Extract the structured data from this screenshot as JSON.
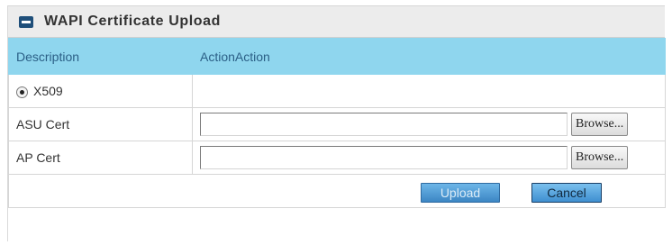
{
  "panel": {
    "title": "WAPI Certificate Upload"
  },
  "table": {
    "headers": [
      "Description",
      "ActionAction"
    ],
    "radio": {
      "label": "X509",
      "checked": true
    },
    "rows": [
      {
        "label": "ASU Cert",
        "value": "",
        "browse_label": "Browse..."
      },
      {
        "label": "AP Cert",
        "value": "",
        "browse_label": "Browse..."
      }
    ]
  },
  "buttons": {
    "upload_label": "Upload",
    "cancel_label": "Cancel"
  },
  "colors": {
    "header_bg": "#8fd6ee",
    "header_text": "#2b5f86",
    "title_icon": "#1f4f7a",
    "button_blue": "#3f8fd0"
  },
  "icons": {
    "title": "panel-minimize-icon"
  }
}
